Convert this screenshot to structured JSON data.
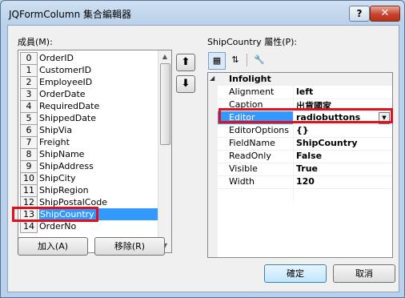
{
  "window": {
    "title": "JQFormColumn 集合編輯器",
    "help_label": "?",
    "close_label": "✕"
  },
  "members": {
    "label": "成員(M):",
    "items": [
      {
        "index": "0",
        "name": "OrderID"
      },
      {
        "index": "1",
        "name": "CustomerID"
      },
      {
        "index": "2",
        "name": "EmployeeID"
      },
      {
        "index": "3",
        "name": "OrderDate"
      },
      {
        "index": "4",
        "name": "RequiredDate"
      },
      {
        "index": "5",
        "name": "ShippedDate"
      },
      {
        "index": "6",
        "name": "ShipVia"
      },
      {
        "index": "7",
        "name": "Freight"
      },
      {
        "index": "8",
        "name": "ShipName"
      },
      {
        "index": "9",
        "name": "ShipAddress"
      },
      {
        "index": "10",
        "name": "ShipCity"
      },
      {
        "index": "11",
        "name": "ShipRegion"
      },
      {
        "index": "12",
        "name": "ShipPostalCode"
      },
      {
        "index": "13",
        "name": "ShipCountry"
      },
      {
        "index": "14",
        "name": "OrderNo"
      }
    ],
    "selected_index": "13",
    "move_up_label": "⬆",
    "move_down_label": "⬇",
    "add_label": "加入(A)",
    "remove_label": "移除(R)"
  },
  "properties": {
    "label": "ShipCountry 屬性(P):",
    "category": "Infolight",
    "rows": [
      {
        "name": "Alignment",
        "value": "left"
      },
      {
        "name": "Caption",
        "value": "出貨國家"
      },
      {
        "name": "Editor",
        "value": "radiobuttons"
      },
      {
        "name": "EditorOptions",
        "value": "{}"
      },
      {
        "name": "FieldName",
        "value": "ShipCountry"
      },
      {
        "name": "ReadOnly",
        "value": "False"
      },
      {
        "name": "Visible",
        "value": "True"
      },
      {
        "name": "Width",
        "value": "120"
      }
    ],
    "selected_row": "Editor"
  },
  "footer": {
    "ok_label": "確定",
    "cancel_label": "取消"
  },
  "colors": {
    "highlight": "#e0101e",
    "selection": "#3399ff"
  }
}
